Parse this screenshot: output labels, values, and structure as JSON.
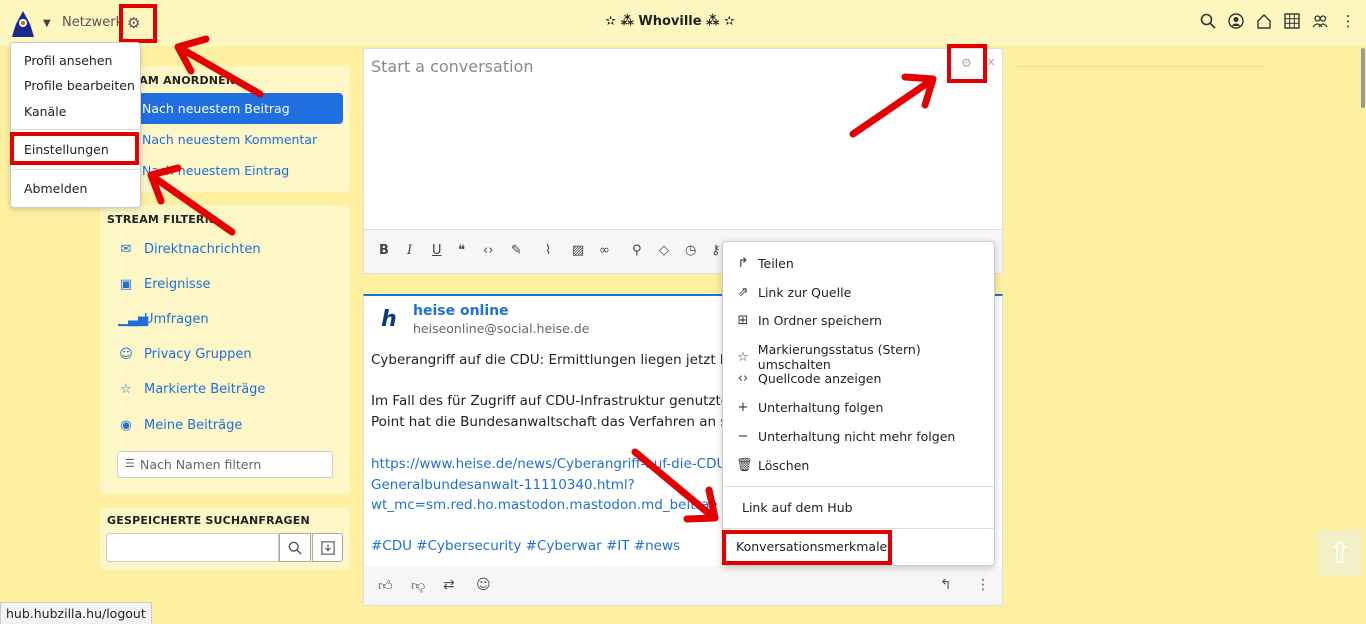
{
  "topbar": {
    "network_label": "Netzwerk",
    "site_title": "✫ ⁂ Whoville ⁂ ✫",
    "nav_icons": [
      "search-icon",
      "user-circle-icon",
      "home-icon",
      "grid-icon",
      "users-icon",
      "more-vertical-icon"
    ]
  },
  "profile_menu": {
    "items": [
      "Profil ansehen",
      "Profile bearbeiten",
      "Kanäle",
      "Einstellungen",
      "Abmelden"
    ]
  },
  "order_panel": {
    "title": "STREAM ANORDNEN",
    "items": [
      "Nach neuestem Beitrag",
      "Nach neuestem Kommentar",
      "Nach neuestem Eintrag"
    ]
  },
  "filter_panel": {
    "title": "STREAM FILTERN",
    "items": [
      "Direktnachrichten",
      "Ereignisse",
      "Umfragen",
      "Privacy Gruppen",
      "Markierte Beiträge",
      "Meine Beiträge"
    ],
    "name_filter_placeholder": "Nach Namen filtern"
  },
  "saved_panel": {
    "title": "GESPEICHERTE SUCHANFRAGEN"
  },
  "compose": {
    "placeholder": "Start a conversation",
    "close": "×"
  },
  "post": {
    "author": "heise online",
    "handle": "heiseonline@social.heise.de",
    "line1": "Cyberangriff auf die CDU: Ermittlungen liegen jetzt bei",
    "line2": "Im Fall des für Zugriff auf CDU-Infrastruktur genutzten",
    "line3": "Point hat die Bundesanwaltschaft das Verfahren an sic",
    "link1": "https://www.heise.de/news/Cyberangriff-auf-die-CDU-E",
    "link2": "Generalbundesanwalt-11110340.html?",
    "link3": "wt_mc=sm.red.ho.mastodon.mastodon.md_beitrae",
    "tags": "#CDU #Cybersecurity #Cyberwar #IT #news"
  },
  "context_menu": {
    "items": [
      "Teilen",
      "Link zur Quelle",
      "In Ordner speichern",
      "Markierungsstatus (Stern) umschalten",
      "Quellcode anzeigen",
      "Unterhaltung folgen",
      "Unterhaltung nicht mehr folgen",
      "Löschen"
    ],
    "hub_link": "Link auf dem Hub",
    "conv_props": "Konversationsmerkmale"
  },
  "status_bar": {
    "url": "hub.hubzilla.hu/logout"
  },
  "colors": {
    "background": "#fdf0a1",
    "accent": "#1f6fe0",
    "highlight": "#e40000"
  }
}
